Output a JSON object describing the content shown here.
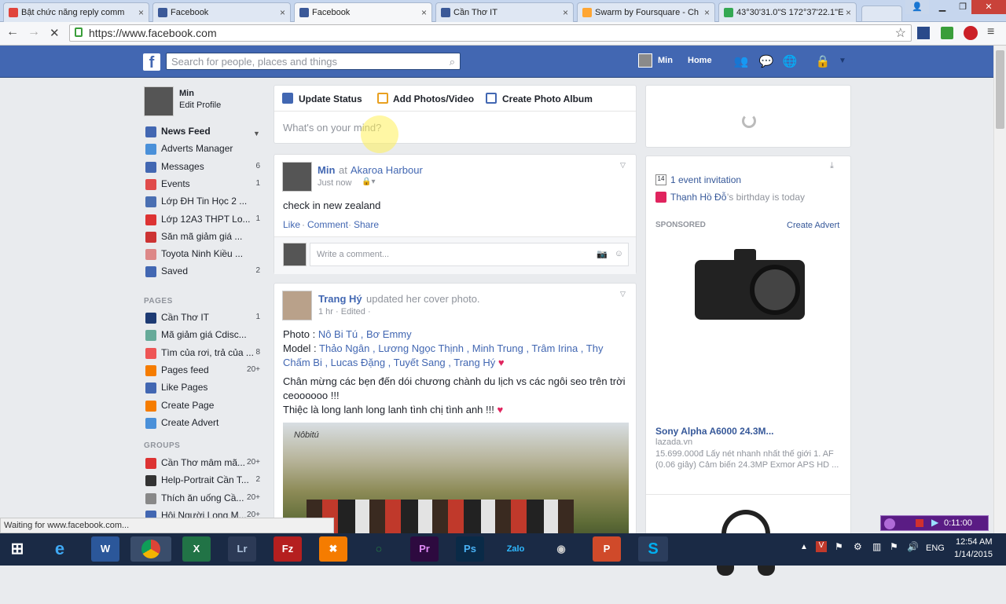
{
  "browser": {
    "tabs": [
      {
        "title": "Bật chức năng reply comm",
        "color": "#e0443c"
      },
      {
        "title": "Facebook",
        "color": "#3b5998"
      },
      {
        "title": "Facebook",
        "color": "#3b5998",
        "active": true
      },
      {
        "title": "Cần Thơ IT",
        "color": "#3b5998"
      },
      {
        "title": "Swarm by Foursquare - Ch",
        "color": "#ffa633"
      },
      {
        "title": "43°30'31.0\"S 172°37'22.1\"E",
        "color": "#34a853"
      }
    ],
    "url": "https://www.facebook.com",
    "status": "Waiting for www.facebook.com..."
  },
  "fb": {
    "search_placeholder": "Search for people, places and things",
    "user": "Min",
    "home": "Home"
  },
  "sidebar": {
    "profile_name": "Min",
    "edit_profile": "Edit Profile",
    "items": [
      {
        "label": "News Feed",
        "count": "",
        "color": "#4267b2"
      },
      {
        "label": "Adverts Manager",
        "count": "",
        "color": "#4a90d9"
      },
      {
        "label": "Messages",
        "count": "6",
        "color": "#4267b2"
      },
      {
        "label": "Events",
        "count": "1",
        "color": "#e04b4b"
      },
      {
        "label": "Lớp ĐH Tin Học 2 ...",
        "count": "",
        "color": "#4a6fb2"
      },
      {
        "label": "Lớp 12A3 THPT Lo...",
        "count": "1",
        "color": "#d33"
      },
      {
        "label": "Săn mã giảm giá ...",
        "count": "",
        "color": "#c33"
      },
      {
        "label": "Toyota Ninh Kiều ...",
        "count": "",
        "color": "#d88"
      },
      {
        "label": "Saved",
        "count": "2",
        "color": "#4267b2"
      }
    ],
    "pages_title": "PAGES",
    "pages": [
      {
        "label": "Cần Thơ IT",
        "count": "1",
        "color": "#1d3a73"
      },
      {
        "label": "Mã giảm giá Cdisc...",
        "count": "",
        "color": "#6a9"
      },
      {
        "label": "Tìm của rơi, trả của ...",
        "count": "8",
        "color": "#e55"
      },
      {
        "label": "Pages feed",
        "count": "20+",
        "color": "#f57c00"
      },
      {
        "label": "Like Pages",
        "count": "",
        "color": "#4267b2"
      },
      {
        "label": "Create Page",
        "count": "",
        "color": "#f57c00"
      },
      {
        "label": "Create Advert",
        "count": "",
        "color": "#4a90d9"
      }
    ],
    "groups_title": "GROUPS",
    "groups": [
      {
        "label": "Cần Thơ mâm mã...",
        "count": "20+",
        "color": "#d33"
      },
      {
        "label": "Help-Portrait Cần T...",
        "count": "2",
        "color": "#333"
      },
      {
        "label": "Thích ăn uống Cầ...",
        "count": "20+",
        "color": "#888"
      },
      {
        "label": "Hội Người Long M...",
        "count": "20+",
        "color": "#4267b2"
      }
    ]
  },
  "composer": {
    "update_status": "Update Status",
    "add_photos": "Add Photos/Video",
    "create_album": "Create Photo Album",
    "placeholder": "What's on your mind?"
  },
  "post1": {
    "author": "Min",
    "at": "at",
    "place": "Akaroa Harbour",
    "time": "Just now",
    "text": "check in new zealand",
    "like": "Like",
    "comment": "Comment",
    "share": "Share",
    "comment_placeholder": "Write a comment..."
  },
  "post2": {
    "author": "Trang Hý",
    "action": "updated her cover photo.",
    "time": "1 hr · Edited ·",
    "photo_label": "Photo :",
    "photo_names": "Nô Bi Tú , Bơ Emmy",
    "model_label": "Model :",
    "model_names": "Thảo Ngân , Lương Ngọc Thịnh , Minh Trung , Trâm Irina , Thy Chấm Bi , Lucas Đặng , Tuyết Sang , Trang Hý",
    "body1": "Chân mừng các bẹn đến dói chương chành du lịch vs các ngôi seo trên trời ceoooooo !!!",
    "body2": "Thiệc là long lanh long lanh tình chị tình anh !!!",
    "watermark": "Nôbitú"
  },
  "right": {
    "event_invite": "1 event invitation",
    "birthday_name": "Thạnh Hồ Đỗ",
    "birthday_text": "'s birthday is today",
    "sponsored": "SPONSORED",
    "create_advert": "Create Advert",
    "ad_title": "Sony Alpha A6000 24.3M...",
    "ad_site": "lazada.vn",
    "ad_desc": "15.699.000đ Lấy nét nhanh nhất thế giới 1. AF (0.06 giây) Cảm biến 24.3MP Exmor APS HD ..."
  },
  "taskbar": {
    "lang": "ENG",
    "time": "12:54 AM",
    "date": "1/14/2015",
    "recorder_time": "0:11:00"
  }
}
